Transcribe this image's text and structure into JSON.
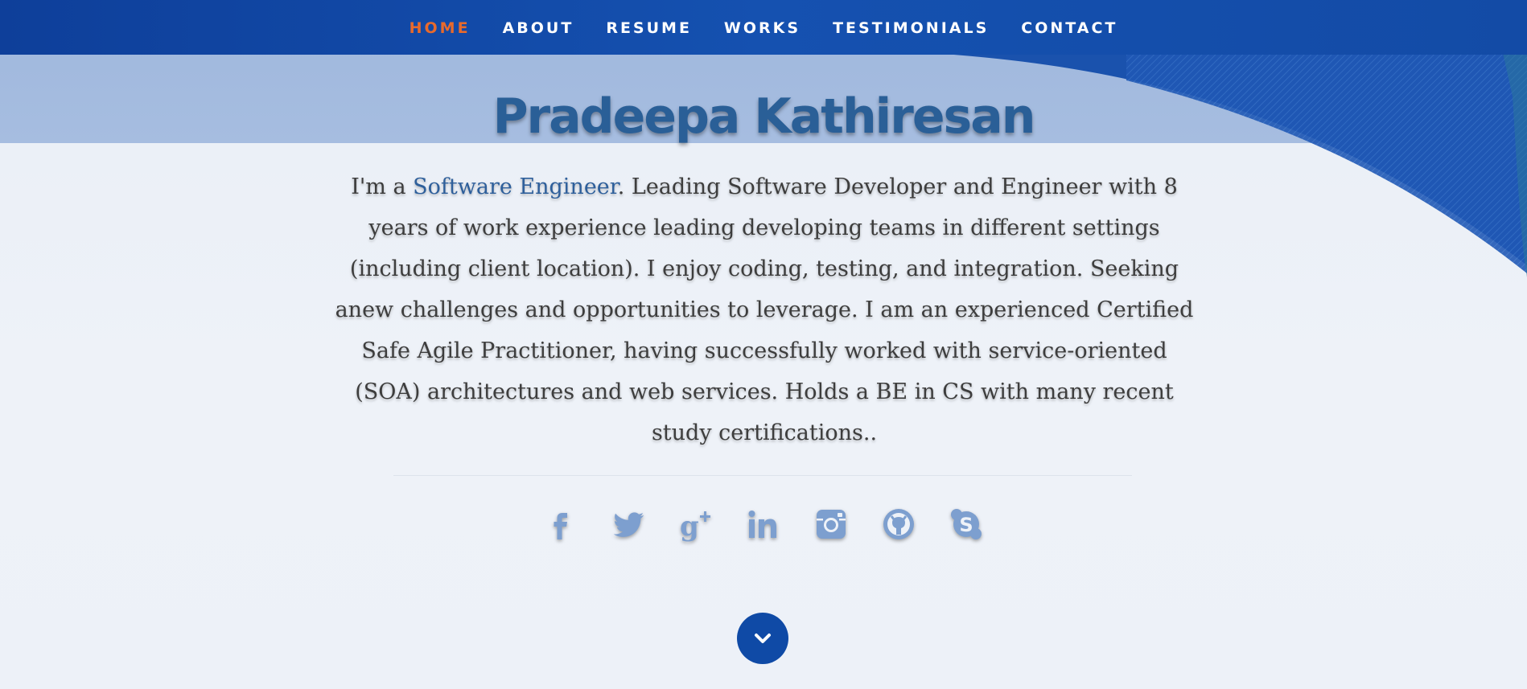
{
  "nav": {
    "items": [
      {
        "label": "HOME",
        "active": true
      },
      {
        "label": "ABOUT"
      },
      {
        "label": "RESUME"
      },
      {
        "label": "WORKS"
      },
      {
        "label": "TESTIMONIALS"
      },
      {
        "label": "CONTACT"
      }
    ]
  },
  "hero": {
    "name": "Pradeepa Kathiresan",
    "bio_prefix": "I'm a ",
    "role": "Software Engineer",
    "bio_rest": ". Leading Software Developer and Engineer with 8 years of work experience leading developing teams in different settings (including client location). I enjoy coding, testing, and integration. Seeking anew challenges and opportunities to leverage. I am an experienced Certified Safe Agile Practitioner, having successfully worked with service-oriented (SOA) architectures and web services. Holds a BE in CS with many recent study certifications.."
  },
  "social": {
    "icons": [
      "facebook-icon",
      "twitter-icon",
      "google-plus-icon",
      "linkedin-icon",
      "instagram-icon",
      "github-icon",
      "skype-icon"
    ]
  },
  "colors": {
    "nav_bg": "#1551b0",
    "nav_active": "#e86a2c",
    "title": "#2a5f97",
    "role_link": "#2e5f9b",
    "icon": "#7d9fcf",
    "scroll_button": "#0f4aa6"
  },
  "scroll_button": {
    "icon": "chevron-down-icon"
  }
}
